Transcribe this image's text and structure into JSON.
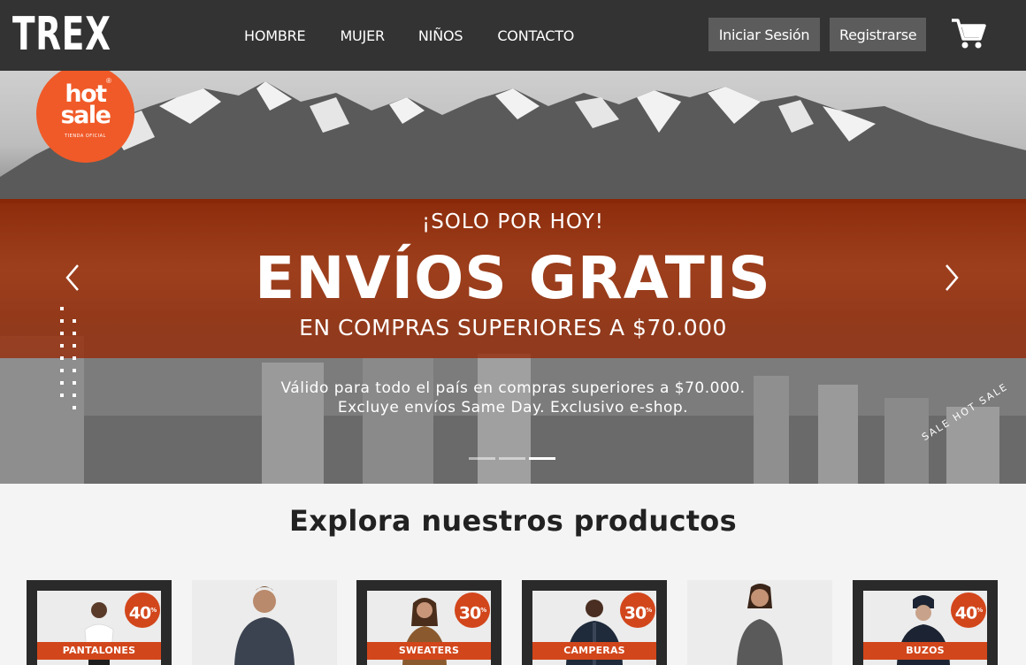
{
  "brand": {
    "logo_text": "TREX"
  },
  "nav": {
    "links": [
      "HOMBRE",
      "MUJER",
      "NIÑOS",
      "CONTACTO"
    ],
    "login_label": "Iniciar Sesión",
    "register_label": "Registrarse",
    "cart_icon": "shopping-cart-icon"
  },
  "hero": {
    "badge_main": "hot sale",
    "badge_sub": "TIENDA OFICIAL",
    "kicker": "¡SOLO POR HOY!",
    "title": "ENVÍOS GRATIS",
    "subtitle": "EN COMPRAS SUPERIORES A $70.000",
    "note_line1": "Válido para todo el país en compras superiores a $70.000.",
    "note_line2": "Excluye envíos Same Day. Exclusivo e-shop.",
    "corner_text": "SALE HOT SALE",
    "slides": 3,
    "active_slide": 3,
    "accent_color": "#f05a28"
  },
  "products": {
    "section_title": "Explora nuestros productos",
    "items": [
      {
        "label": "PANTALONES",
        "badge": "40",
        "badge_suffix": "%"
      },
      {
        "label": "",
        "badge": ""
      },
      {
        "label": "SWEATERS",
        "badge": "30",
        "badge_suffix": "%"
      },
      {
        "label": "CAMPERAS",
        "badge": "30",
        "badge_suffix": "%"
      },
      {
        "label": "",
        "badge": ""
      },
      {
        "label": "BUZOS",
        "badge": "40",
        "badge_suffix": "%"
      }
    ]
  }
}
